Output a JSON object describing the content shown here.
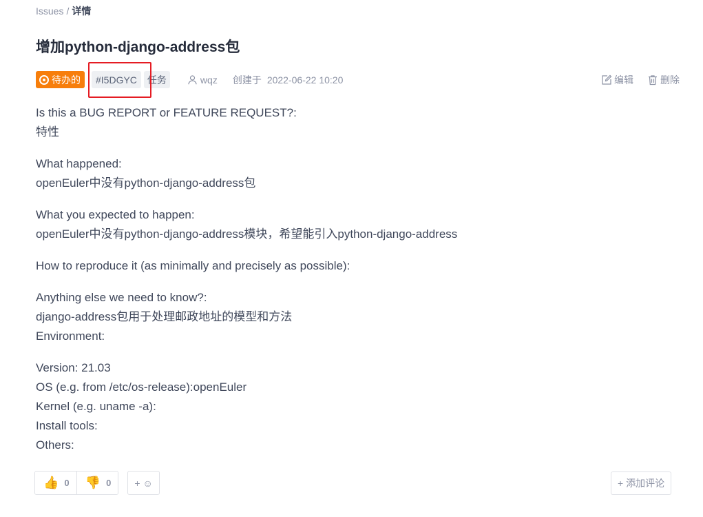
{
  "breadcrumb": {
    "root": "Issues",
    "separator": "/",
    "current": "详情"
  },
  "issue": {
    "title": "增加python-django-address包",
    "state": "待办的",
    "id": "#I5DGYC",
    "type": "任务",
    "author": "wqz",
    "created_label": "创建于",
    "created_at": "2022-06-22 10:20"
  },
  "actions": {
    "edit": "编辑",
    "delete": "删除"
  },
  "body": {
    "q1": "Is this a BUG REPORT or FEATURE REQUEST?:",
    "a1": "特性",
    "q2": "What happened:",
    "a2": "openEuler中没有python-django-address包",
    "q3": "What you expected to happen:",
    "a3": "openEuler中没有python-django-address模块，希望能引入python-django-address",
    "q4": "How to reproduce it (as minimally and precisely as possible):",
    "q5": "Anything else we need to know?:",
    "a5": "django-address包用于处理邮政地址的模型和方法",
    "env": "Environment:",
    "version": "Version: 21.03",
    "os": "OS (e.g. from /etc/os-release):openEuler",
    "kernel": "Kernel (e.g. uname -a):",
    "install": "Install tools:",
    "others": "Others:"
  },
  "reactions": {
    "thumbs_up_count": "0",
    "thumbs_down_count": "0",
    "add_plus": "+",
    "add_icon": "☺"
  },
  "comment": {
    "plus": "+",
    "label": "添加评论"
  },
  "colors": {
    "state_badge": "#f77e0b",
    "highlight": "#e51c23",
    "text": "#40485b",
    "muted": "#8c92a4"
  }
}
